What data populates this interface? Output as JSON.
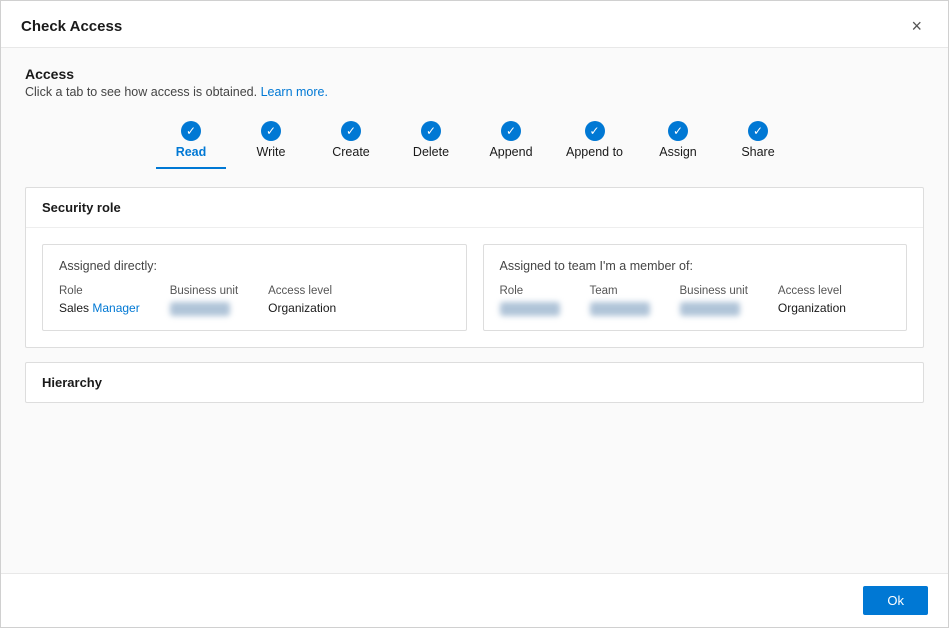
{
  "dialog": {
    "title": "Check Access",
    "close_label": "×"
  },
  "access": {
    "section_title": "Access",
    "description": "Click a tab to see how access is obtained.",
    "learn_more": "Learn more."
  },
  "tabs": [
    {
      "id": "read",
      "label": "Read",
      "active": true
    },
    {
      "id": "write",
      "label": "Write",
      "active": false
    },
    {
      "id": "create",
      "label": "Create",
      "active": false
    },
    {
      "id": "delete",
      "label": "Delete",
      "active": false
    },
    {
      "id": "append",
      "label": "Append",
      "active": false
    },
    {
      "id": "append_to",
      "label": "Append to",
      "active": false
    },
    {
      "id": "assign",
      "label": "Assign",
      "active": false
    },
    {
      "id": "share",
      "label": "Share",
      "active": false
    }
  ],
  "security_role": {
    "header": "Security role",
    "assigned_directly": {
      "title": "Assigned directly:",
      "columns": {
        "role_header": "Role",
        "role_value_prefix": "Sales ",
        "role_value_link": "Manager",
        "business_unit_header": "Business unit",
        "access_level_header": "Access level",
        "access_level_value": "Organization"
      }
    },
    "assigned_to_team": {
      "title": "Assigned to team I'm a member of:",
      "columns": {
        "role_header": "Role",
        "team_header": "Team",
        "business_unit_header": "Business unit",
        "access_level_header": "Access level",
        "access_level_value": "Organization"
      }
    }
  },
  "hierarchy": {
    "header": "Hierarchy"
  },
  "footer": {
    "ok_label": "Ok"
  }
}
